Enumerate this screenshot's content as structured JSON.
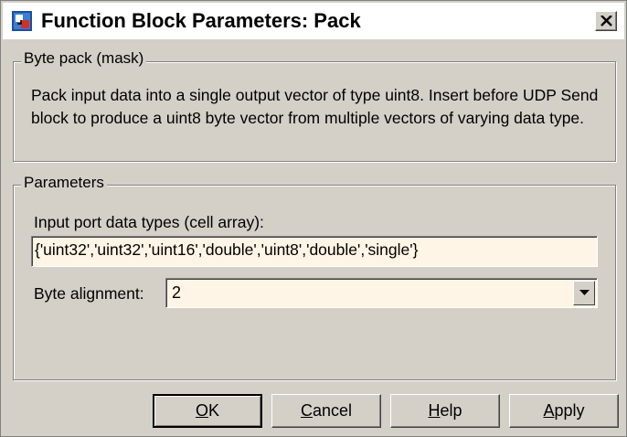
{
  "window": {
    "title": "Function Block Parameters: Pack",
    "icon": "simulink-block-icon",
    "close_symbol": "X"
  },
  "mask_group": {
    "label": "Byte pack (mask)",
    "description": "Pack input data into a single output vector of type uint8. Insert before UDP Send block to produce a uint8 byte vector from multiple vectors of varying data type."
  },
  "parameters_group": {
    "label": "Parameters",
    "input_types": {
      "label": "Input port data types (cell array):",
      "value": "{'uint32','uint32','uint16','double','uint8','double','single'}"
    },
    "byte_alignment": {
      "label": "Byte alignment:",
      "value": "2"
    }
  },
  "buttons": {
    "ok": {
      "mnemonic": "O",
      "rest": "K"
    },
    "cancel": {
      "mnemonic": "C",
      "rest": "ancel"
    },
    "help": {
      "mnemonic": "H",
      "rest": "elp"
    },
    "apply": {
      "mnemonic": "A",
      "rest": "pply"
    }
  },
  "colors": {
    "dialog_bg": "#d4d0c8",
    "field_bg": "#fff5e6",
    "title_bg": "#ffffff"
  }
}
